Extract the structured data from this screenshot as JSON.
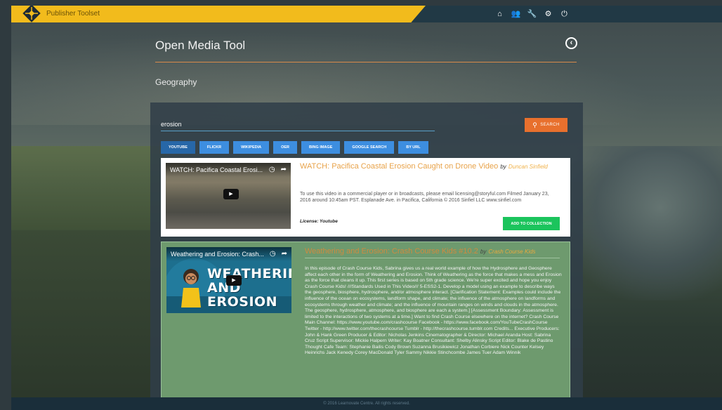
{
  "app": {
    "brand": "Publisher Toolset"
  },
  "nav": {
    "icons": [
      "home-icon",
      "users-icon",
      "wrench-icon",
      "gear-icon",
      "power-icon"
    ],
    "glyphs": [
      "⌂",
      "👥",
      "🔧",
      "⚙",
      "⏻"
    ]
  },
  "header": {
    "title": "Open Media Tool",
    "back_glyph": "‹",
    "subtitle": "Geography"
  },
  "search": {
    "value": "erosion",
    "button_label": "SEARCH",
    "button_icon": "⚲"
  },
  "tabs": [
    {
      "label": "YOUTUBE",
      "active": true
    },
    {
      "label": "FLICKR",
      "active": false
    },
    {
      "label": "WIKIPEDIA",
      "active": false
    },
    {
      "label": "OER",
      "active": false
    },
    {
      "label": "BING IMAGE",
      "active": false
    },
    {
      "label": "GOOGLE SEARCH",
      "active": false
    },
    {
      "label": "BY URL",
      "active": false
    }
  ],
  "results": [
    {
      "video_title": "WATCH: Pacifica Coastal Erosi...",
      "title": "WATCH: Pacifica Coastal Erosion Caught on Drone Video",
      "by": "by",
      "author": "Duncan Sinfield",
      "description": "To use this video in a commercial player or in broadcasts, please email licensing@storyful.com Filmed January 23, 2016 around 10:45am PST. Esplanade Ave. in Pacifica, California © 2016 Sinfiel LLC www.sinfiel.com",
      "license": "License: Youtube",
      "add_label": "ADD TO COLLECTION"
    },
    {
      "video_title": "Weathering and Erosion: Crash...",
      "thumb_text": "WEATHERING AND EROSION",
      "title": "Weathering and Erosion: Crash Course Kids #10.2",
      "by": "by",
      "author": "Crash Course Kids",
      "description": "In this episode of Crash Course Kids, Sabrina gives us a real world example of how the Hydrosphere and Geosphere affect each other in the form of Weathering and Erosion. Think of Weathering as the force that makes a mess and Erosion as the force that cleans it up. This first series is based on 5th grade science. We're super excited and hope you enjoy Crash Course Kids! ///Standards Used in This Video/// 5-ESS2-1. Develop a model using an example to describe ways the geosphere, biosphere, hydrosphere, and/or atmosphere interact. [Clarification Statement: Examples could include the influence of the ocean on ecosystems, landform shape, and climate; the influence of the atmosphere on landforms and ecosystems through weather and climate; and the influence of mountain ranges on winds and clouds in the atmosphere. The geosphere, hydrosphere, atmosphere, and biosphere are each a system.] [Assessment Boundary: Assessment is limited to the interactions of two systems at a time.] Want to find Crash Course elsewhere on the internet? Crash Course Main Channel: https://www.youtube.com/crashcourse Facebook - https://www.facebook.com/YouTubeCrashCourse Twitter - http://www.twitter.com/thecrashcourse Tumblr - http://thecrashcourse.tumblr.com Credits... Executive Producers: John & Hank Green Producer & Editor: Nicholas Jenkins Cinematographer & Director: Michael Aranda Host: Sabrina Cruz Script Supervisor: Mickie Halpern Writer: Kay Boatner Consultant: Shelby Alinsky Script Editor: Blake de Pastino Thought Cafe Team: Stephanie Bailis Cody Brown Suzanna Brusikiewicz Jonathan Corbiere Nick Counter Kelsey Heinrichs Jack Kenedy Corey MacDonald Tyler Sammy Nikkie Stinchcombe James Tuer Adam Winnik"
    }
  ],
  "footer": {
    "text": "© 2016 Learnovate Centre. All rights reserved."
  },
  "colors": {
    "brand_gold": "#f2bb1c",
    "topbar": "#213945",
    "search_orange": "#e8702d",
    "tab_blue": "#3d8ee0",
    "add_green": "#1bc45c"
  }
}
